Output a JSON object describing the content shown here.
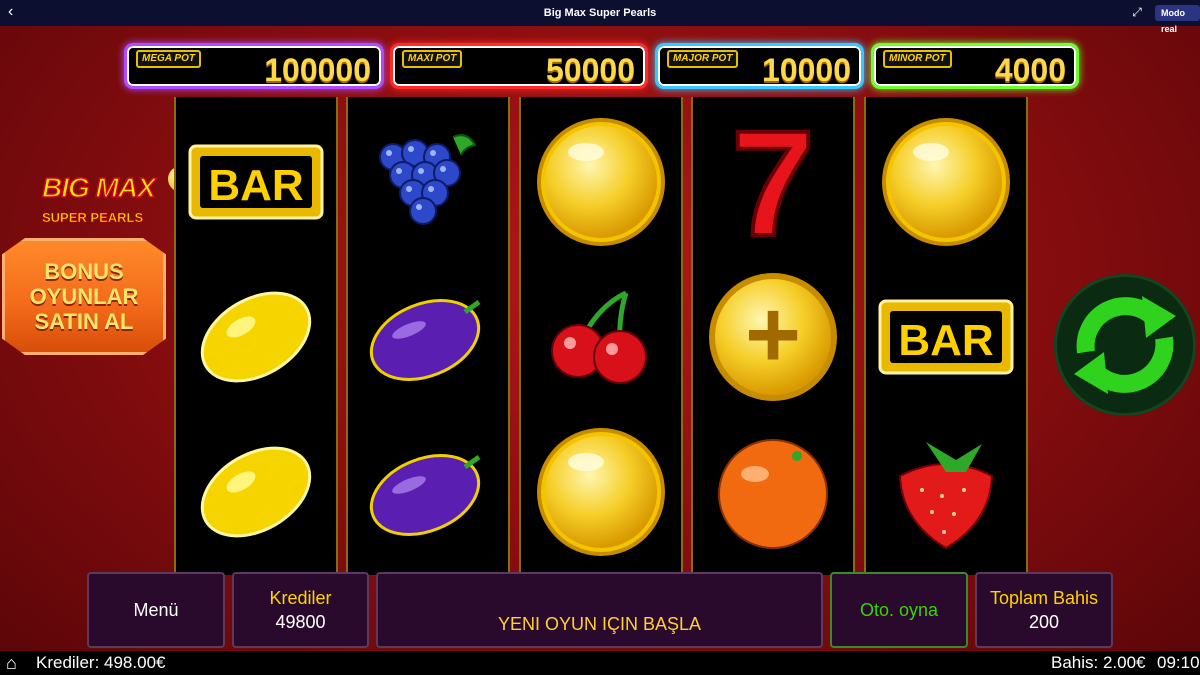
{
  "topbar": {
    "title": "Big Max Super Pearls",
    "mode_label": "Modo real"
  },
  "jackpots": [
    {
      "label": "MEGA POT",
      "value": "100000",
      "color": "#b04cff"
    },
    {
      "label": "MAXI POT",
      "value": "50000",
      "color": "#ff2a2a"
    },
    {
      "label": "MAJOR POT",
      "value": "10000",
      "color": "#37c8ff"
    },
    {
      "label": "MINOR POT",
      "value": "4000",
      "color": "#6cff2a"
    }
  ],
  "logo": {
    "line1": "BIG MAX",
    "coin": "$",
    "line2": "SUPER PEARLS"
  },
  "bonus_button": {
    "lines": [
      "BONUS",
      "OYUNLAR",
      "SATIN AL"
    ]
  },
  "reels": [
    [
      "bar",
      "lemon",
      "lemon"
    ],
    [
      "grapes",
      "plum",
      "plum"
    ],
    [
      "pearl",
      "cherries",
      "pearl"
    ],
    [
      "seven",
      "plus-pearl",
      "orange"
    ],
    [
      "pearl",
      "bar",
      "strawberry"
    ]
  ],
  "symbol_text": {
    "bar": "BAR",
    "seven": "7",
    "plus": "+"
  },
  "spin_button": {
    "icon": "spin-arrows-icon",
    "color": "#2fd21c"
  },
  "panels": {
    "menu": "Menü",
    "credits_label": "Krediler",
    "credits_value": "49800",
    "start": "YENI OYUN IÇIN BAŞLA",
    "autoplay": "Oto. oyna",
    "total_bet_label": "Toplam Bahis",
    "total_bet_value": "200"
  },
  "statusbar": {
    "credits": "Krediler: 498.00€",
    "bet": "Bahis: 2.00€",
    "time": "09:10"
  }
}
